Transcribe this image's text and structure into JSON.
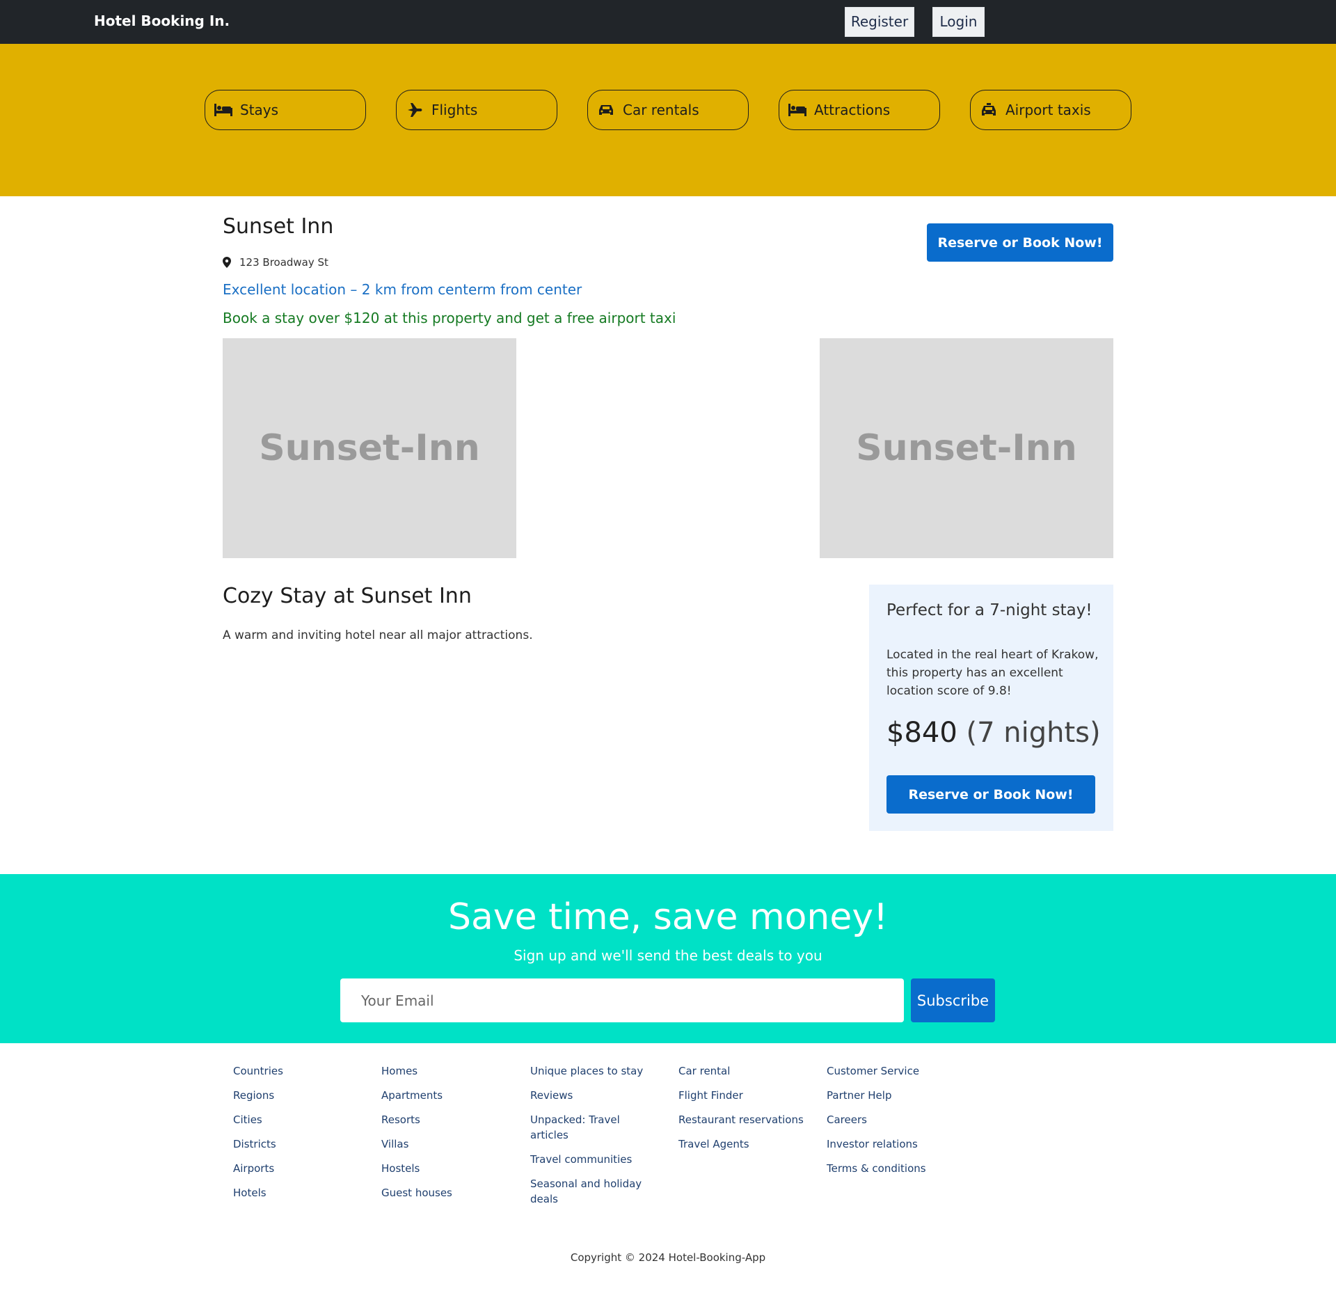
{
  "navbar": {
    "brand": "Hotel Booking In.",
    "register_label": "Register",
    "login_label": "Login"
  },
  "categories": [
    {
      "label": "Stays",
      "icon": "bed-icon"
    },
    {
      "label": "Flights",
      "icon": "plane-icon"
    },
    {
      "label": "Car rentals",
      "icon": "car-icon"
    },
    {
      "label": "Attractions",
      "icon": "bed-icon"
    },
    {
      "label": "Airport taxis",
      "icon": "taxi-icon"
    }
  ],
  "hotel": {
    "name": "Sunset Inn",
    "address": "123 Broadway St",
    "location_note": "Excellent location – 2 km from centerm from center",
    "promo": "Book a stay over $120 at this property and get a free airport taxi",
    "reserve_label": "Reserve or Book Now!",
    "images": [
      "Sunset-Inn",
      "Sunset-Inn"
    ],
    "desc_title": "Cozy Stay at Sunset Inn",
    "desc_text": "A warm and inviting hotel near all major attractions."
  },
  "price_card": {
    "title": "Perfect for a 7-night stay!",
    "text": "Located in the real heart of Krakow, this property has an excellent location score of 9.8!",
    "price": "$840",
    "nights": "(7 nights)",
    "button_label": "Reserve or Book Now!"
  },
  "newsletter": {
    "title": "Save time, save money!",
    "subtitle": "Sign up and we'll send the best deals to you",
    "email_placeholder": "Your Email",
    "subscribe_label": "Subscribe"
  },
  "footer": {
    "columns": [
      [
        "Countries",
        "Regions",
        "Cities",
        "Districts",
        "Airports",
        "Hotels"
      ],
      [
        "Homes",
        "Apartments",
        "Resorts",
        "Villas",
        "Hostels",
        "Guest houses"
      ],
      [
        "Unique places to stay",
        "Reviews",
        "Unpacked: Travel articles",
        "Travel communities",
        "Seasonal and holiday deals"
      ],
      [
        "Car rental",
        "Flight Finder",
        "Restaurant reservations",
        "Travel Agents"
      ],
      [
        "Customer Service",
        "Partner Help",
        "Careers",
        "Investor relations",
        "Terms & conditions"
      ]
    ],
    "copyright": "Copyright © 2024 Hotel-Booking-App"
  },
  "colors": {
    "navbar": "#212529",
    "header": "#e0b000",
    "primary": "#0a6ccc",
    "newsletter": "#00e1c6",
    "price_card_bg": "#ebf3fd"
  }
}
